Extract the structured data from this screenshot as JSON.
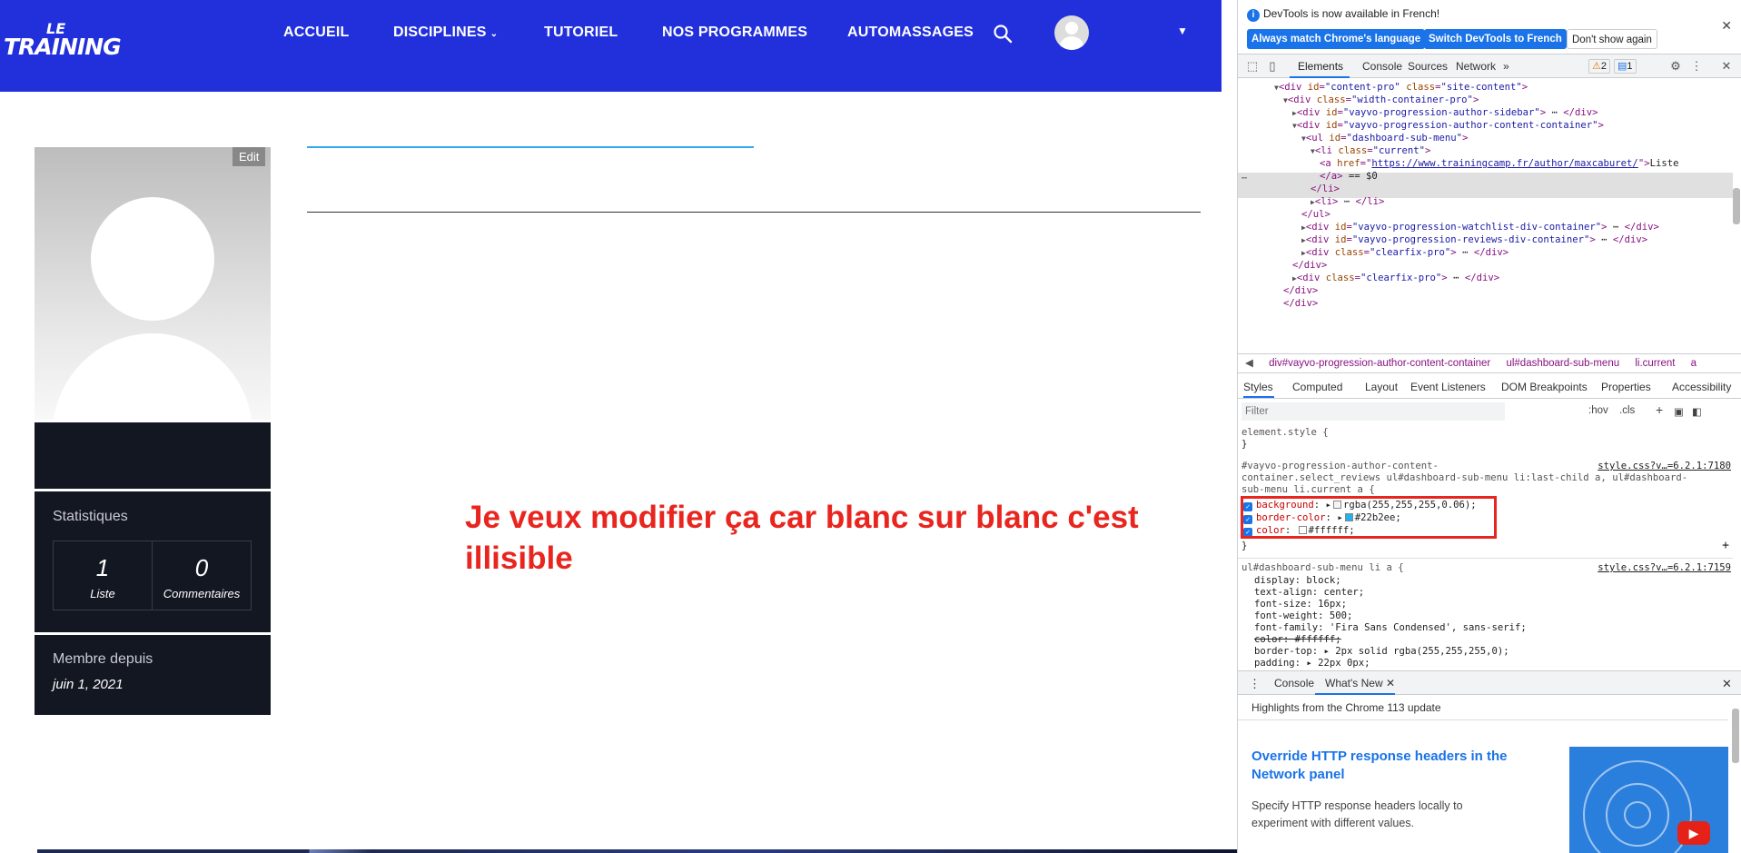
{
  "site": {
    "logo": {
      "line1": "LE",
      "line2": "TRAINING"
    },
    "nav": [
      {
        "label": "ACCUEIL"
      },
      {
        "label": "DISCIPLINES"
      },
      {
        "label": "TUTORIEL"
      },
      {
        "label": "NOS PROGRAMMES"
      },
      {
        "label": "AUTOMASSAGES"
      }
    ],
    "edit_label": "Edit",
    "stats": {
      "title": "Statistiques",
      "list_count": "1",
      "list_label": "Liste",
      "comments_count": "0",
      "comments_label": "Commentaires"
    },
    "member": {
      "title": "Membre depuis",
      "date": "juin 1, 2021"
    },
    "annotation": "Je veux modifier ça car blanc sur blanc c'est illisible",
    "colors": {
      "nav_bg": "#2230dc",
      "panel_bg": "#131722",
      "annotation": "#e8251e",
      "accent_line": "#2fa8f0"
    }
  },
  "devtools": {
    "infobar": {
      "message": "DevTools is now available in French!",
      "btn_match": "Always match Chrome's language",
      "btn_switch": "Switch DevTools to French",
      "btn_dismiss": "Don't show again"
    },
    "tabs": [
      "Elements",
      "Console",
      "Sources",
      "Network"
    ],
    "more_tabs": "»",
    "warnings": "2",
    "messages": "1",
    "dom": [
      {
        "indent": 2,
        "tri": "▼",
        "parts": [
          [
            "t",
            "<div "
          ],
          [
            "a",
            "id"
          ],
          [
            "t",
            "="
          ],
          [
            "v",
            "\"content-pro\""
          ],
          [
            "t",
            " "
          ],
          [
            "a",
            "class"
          ],
          [
            "t",
            "="
          ],
          [
            "v",
            "\"site-content\""
          ],
          [
            "t",
            ">"
          ]
        ]
      },
      {
        "indent": 3,
        "tri": "▼",
        "parts": [
          [
            "t",
            "<div "
          ],
          [
            "a",
            "class"
          ],
          [
            "t",
            "="
          ],
          [
            "v",
            "\"width-container-pro\""
          ],
          [
            "t",
            ">"
          ]
        ]
      },
      {
        "indent": 4,
        "tri": "▶",
        "parts": [
          [
            "t",
            "<div "
          ],
          [
            "a",
            "id"
          ],
          [
            "t",
            "="
          ],
          [
            "v",
            "\"vayvo-progression-author-sidebar\""
          ],
          [
            "t",
            ">"
          ],
          [
            "x",
            " ⋯ "
          ],
          [
            "t",
            "</div>"
          ]
        ]
      },
      {
        "indent": 4,
        "tri": "▼",
        "parts": [
          [
            "t",
            "<div "
          ],
          [
            "a",
            "id"
          ],
          [
            "t",
            "="
          ],
          [
            "v",
            "\"vayvo-progression-author-content-container\""
          ],
          [
            "t",
            ">"
          ]
        ]
      },
      {
        "indent": 5,
        "tri": "▼",
        "parts": [
          [
            "t",
            "<ul "
          ],
          [
            "a",
            "id"
          ],
          [
            "t",
            "="
          ],
          [
            "v",
            "\"dashboard-sub-menu\""
          ],
          [
            "t",
            ">"
          ]
        ]
      },
      {
        "indent": 6,
        "tri": "▼",
        "parts": [
          [
            "t",
            "<li "
          ],
          [
            "a",
            "class"
          ],
          [
            "t",
            "="
          ],
          [
            "v",
            "\"current\""
          ],
          [
            "t",
            ">"
          ]
        ]
      },
      {
        "indent": 7,
        "tri": "",
        "parts": [
          [
            "t",
            "<a "
          ],
          [
            "a",
            "href"
          ],
          [
            "t",
            "=\""
          ],
          [
            "l",
            "https://www.trainingcamp.fr/author/maxcaburet/"
          ],
          [
            "t",
            "\">"
          ],
          [
            "x",
            "Liste"
          ]
        ]
      },
      {
        "indent": 7,
        "tri": "",
        "parts": [
          [
            "t",
            "</a>"
          ],
          [
            "x",
            " == $0"
          ]
        ]
      },
      {
        "indent": 6,
        "tri": "",
        "parts": [
          [
            "t",
            "</li>"
          ]
        ]
      },
      {
        "indent": 6,
        "tri": "▶",
        "parts": [
          [
            "t",
            "<li>"
          ],
          [
            "x",
            " ⋯ "
          ],
          [
            "t",
            "</li>"
          ]
        ]
      },
      {
        "indent": 5,
        "tri": "",
        "parts": [
          [
            "t",
            "</ul>"
          ]
        ]
      },
      {
        "indent": 5,
        "tri": "▶",
        "parts": [
          [
            "t",
            "<div "
          ],
          [
            "a",
            "id"
          ],
          [
            "t",
            "="
          ],
          [
            "v",
            "\"vayvo-progression-watchlist-div-container\""
          ],
          [
            "t",
            ">"
          ],
          [
            "x",
            " ⋯ "
          ],
          [
            "t",
            "</div>"
          ]
        ]
      },
      {
        "indent": 5,
        "tri": "▶",
        "parts": [
          [
            "t",
            "<div "
          ],
          [
            "a",
            "id"
          ],
          [
            "t",
            "="
          ],
          [
            "v",
            "\"vayvo-progression-reviews-div-container\""
          ],
          [
            "t",
            ">"
          ],
          [
            "x",
            " ⋯ "
          ],
          [
            "t",
            "</div>"
          ]
        ]
      },
      {
        "indent": 5,
        "tri": "▶",
        "parts": [
          [
            "t",
            "<div "
          ],
          [
            "a",
            "class"
          ],
          [
            "t",
            "="
          ],
          [
            "v",
            "\"clearfix-pro\""
          ],
          [
            "t",
            ">"
          ],
          [
            "x",
            " ⋯ "
          ],
          [
            "t",
            "</div>"
          ]
        ]
      },
      {
        "indent": 4,
        "tri": "",
        "parts": [
          [
            "t",
            "</div>"
          ]
        ]
      },
      {
        "indent": 4,
        "tri": "▶",
        "parts": [
          [
            "t",
            "<div "
          ],
          [
            "a",
            "class"
          ],
          [
            "t",
            "="
          ],
          [
            "v",
            "\"clearfix-pro\""
          ],
          [
            "t",
            ">"
          ],
          [
            "x",
            " ⋯ "
          ],
          [
            "t",
            "</div>"
          ]
        ]
      },
      {
        "indent": 3,
        "tri": "",
        "parts": [
          [
            "t",
            "</div>"
          ]
        ]
      },
      {
        "indent": 3,
        "tri": "",
        "parts": [
          [
            "t",
            "</div>"
          ]
        ]
      }
    ],
    "breadcrumbs": [
      "div#vayvo-progression-author-content-container",
      "ul#dashboard-sub-menu",
      "li.current",
      "a"
    ],
    "subtabs": [
      "Styles",
      "Computed",
      "Layout",
      "Event Listeners",
      "DOM Breakpoints",
      "Properties",
      "Accessibility"
    ],
    "filter_placeholder": "Filter",
    "filter_hov": ":hov",
    "filter_cls": ".cls",
    "styles": {
      "element_style": "element.style {",
      "close": "}",
      "rule1_selector_1": "#vayvo-progression-author-content-",
      "rule1_selector_2": "container.select_reviews ul#dashboard-sub-menu li:last-child a, ul#dashboard-",
      "rule1_selector_3": "sub-menu li.current a {",
      "rule1_source": "style.css?v…=6.2.1:7180",
      "rule1_props": [
        {
          "name": "background",
          "value": "rgba(255,255,255,0.06);",
          "swatch": "#f5f5f5"
        },
        {
          "name": "border-color",
          "value": "#22b2ee;",
          "swatch": "#22b2ee"
        },
        {
          "name": "color",
          "value": "#ffffff;",
          "swatch": "#ffffff"
        }
      ],
      "rule2_selector": "ul#dashboard-sub-menu li a {",
      "rule2_source": "style.css?v…=6.2.1:7159",
      "rule2_props": [
        "display: block;",
        "text-align: center;",
        "font-size: 16px;",
        "font-weight: 500;",
        "font-family: 'Fira Sans Condensed', sans-serif;",
        "color: #ffffff;",
        "border-top: ▸ 2px solid rgba(255,255,255,0);",
        "padding: ▸ 22px 0px;"
      ]
    },
    "drawer": {
      "tab_console": "Console",
      "tab_whatsnew": "What's New",
      "highlights": "Highlights from the Chrome 113 update",
      "title": "Override HTTP response headers in the Network panel",
      "desc": "Specify HTTP response headers locally to experiment with different values."
    }
  }
}
